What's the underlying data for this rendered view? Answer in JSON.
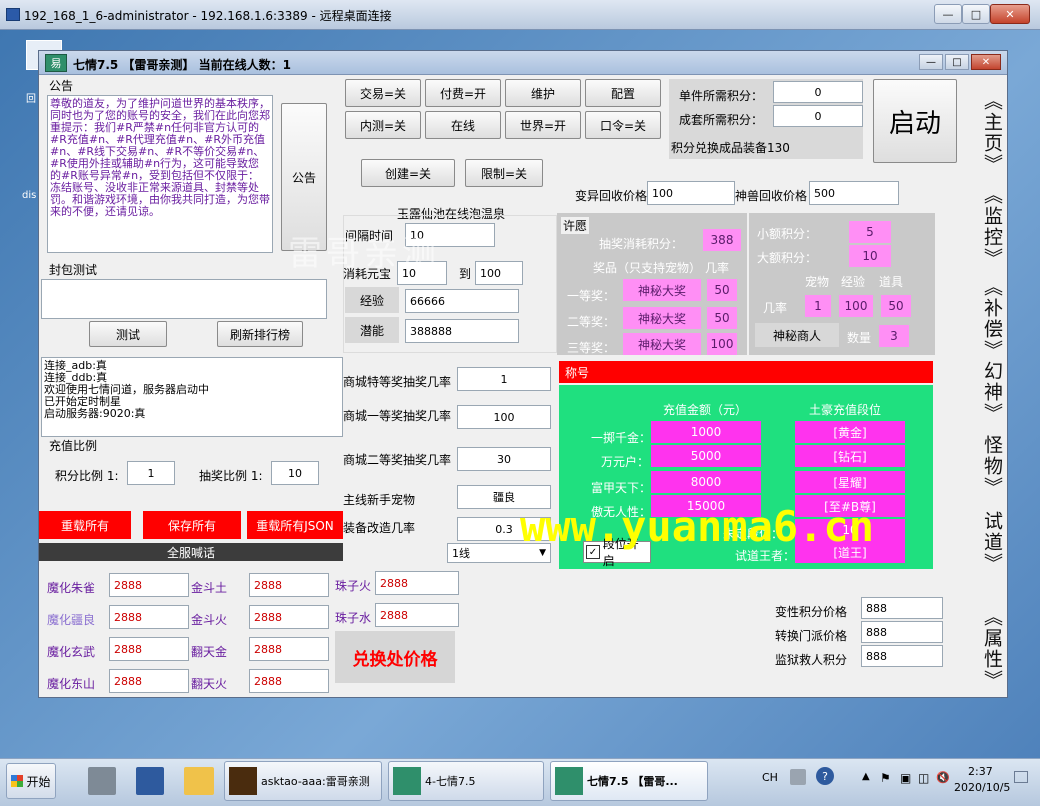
{
  "rdp": {
    "title": "192_168_1_6-administrator - 192.168.1.6:3389 - 远程桌面连接",
    "min": "—",
    "max": "□",
    "close": "✕"
  },
  "desktop": {
    "icon1": "回",
    "icon2": "dis"
  },
  "app": {
    "logo": "易",
    "title": "七情7.5 【雷哥亲测】 当前在线人数：1",
    "min": "—",
    "max": "□",
    "close": "✕",
    "notice": {
      "label": "公告",
      "text": "尊敬的道友，为了维护问道世界的基本秩序，同时也为了您的账号的安全，我们在此向您郑重提示：我们#R严禁#n任何非官方认可的#R充值#n、#R代理充值#n、#R外币充值#n、#R线下交易#n、#R不等价交易#n、#R使用外挂或辅助#n行为，这可能导致您的#R账号异常#n，受到包括但不仅限于：冻结账号、没收非正常来源道具、封禁等处罚。和谐游戏环境，由你我共同打造，为您带来的不便，还请见谅。",
      "button": "公告"
    },
    "packet": {
      "label": "封包测试",
      "test_button": "测试",
      "refresh_button": "刷新排行榜"
    },
    "log": [
      "连接_adb:真",
      "连接_ddb:真",
      "欢迎使用七情问道，服务器启动中",
      "已开始定时制星",
      "启动服务器:9020:真"
    ],
    "recharge": {
      "label": "充值比例",
      "points_label": "积分比例 1:",
      "points_value": "1",
      "lottery_label": "抽奖比例 1:",
      "lottery_value": "10"
    },
    "reload_all": "重载所有",
    "save_all": "保存所有",
    "reload_json": "重载所有JSON",
    "broadcast_label": "全服喊话",
    "exchange": [
      {
        "name": "魔化朱雀",
        "value": "2888"
      },
      {
        "name": "金斗土",
        "value": "2888"
      },
      {
        "name": "珠子火",
        "value": "2888"
      },
      {
        "name": "魔化疆良",
        "value": "2888"
      },
      {
        "name": "金斗火",
        "value": "2888"
      },
      {
        "name": "珠子水",
        "value": "2888"
      },
      {
        "name": "魔化玄武",
        "value": "2888"
      },
      {
        "name": "翻天金",
        "value": "2888"
      },
      {
        "name": "魔化东山",
        "value": "2888"
      },
      {
        "name": "翻天火",
        "value": "2888"
      }
    ],
    "exchange_price_label": "兑换处价格",
    "toggles": [
      "交易=关",
      "付费=开",
      "维护",
      "配置",
      "内测=关",
      "在线",
      "世界=开",
      "口令=关"
    ],
    "create_button": "创建=关",
    "limit_button": "限制=关",
    "pool": {
      "label": "玉露仙池在线泡温泉",
      "interval_label": "间隔时间",
      "interval_value": "10",
      "consume_label": "消耗元宝",
      "consume_value": "10",
      "to_label": "到",
      "to_value": "100",
      "exp_label": "经验",
      "exp_value": "66666",
      "potential_label": "潜能",
      "potential_value": "388888"
    },
    "mall": {
      "special_label": "商城特等奖抽奖几率",
      "special_value": "1",
      "first_label": "商城一等奖抽奖几率",
      "first_value": "100",
      "second_label": "商城二等奖抽奖几率",
      "second_value": "30",
      "pet_label": "主线新手宠物",
      "pet_value": "疆良",
      "modify_label": "装备改造几率",
      "modify_value": "0.3",
      "line_select": "1线",
      "select_arrow": "▼"
    },
    "points": {
      "single_label": "单件所需积分：",
      "single_value": "0",
      "set_label": "成套所需积分：",
      "set_value": "0",
      "exchange_note": "积分兑换成品装备130"
    },
    "start_button": "启动",
    "recycle": {
      "variant_label": "变异回收价格",
      "variant_value": "100",
      "beast_label": "神兽回收价格",
      "beast_value": "500"
    },
    "wish": {
      "label": "许愿",
      "cost_label": "抽奖消耗积分：",
      "cost_value": "388",
      "prize_header": "奖品（只支持宠物）",
      "rate_header": "几率",
      "prizes": [
        {
          "label": "一等奖：",
          "name": "神秘大奖",
          "rate": "50"
        },
        {
          "label": "二等奖：",
          "name": "神秘大奖",
          "rate": "50"
        },
        {
          "label": "三等奖：",
          "name": "神秘大奖",
          "rate": "100"
        }
      ]
    },
    "amount": {
      "small_label": "小额积分：",
      "small_value": "5",
      "large_label": "大额积分：",
      "large_value": "10",
      "col_pet": "宠物",
      "col_exp": "经验",
      "col_item": "道具",
      "rate_label": "几率",
      "rate_pet": "1",
      "rate_exp": "100",
      "rate_item": "50",
      "merchant_label": "神秘商人",
      "count_label": "数量",
      "count_value": "3"
    },
    "titles": {
      "header": "称号",
      "amount_header": "充值金额（元）",
      "rank_header": "土豪充值段位",
      "rows": [
        {
          "label": "一掷千金：",
          "amount": "1000",
          "rank": "[黄金]"
        },
        {
          "label": "万元户：",
          "amount": "5000",
          "rank": "[钻石]"
        },
        {
          "label": "富甲天下：",
          "amount": "8000",
          "rank": "[星耀]"
        },
        {
          "label": "傲无人性：",
          "amount": "15000",
          "rank": "[至#B尊]"
        },
        {
          "label": "未定段位：",
          "amount": "10",
          "rank": "[10拥]"
        },
        {
          "label": "试道王者：",
          "amount": "",
          "rank": "[道王]"
        }
      ],
      "toggle_label": "段位开启",
      "check_mark": "✓"
    },
    "misc": {
      "gender_label": "变性积分价格",
      "gender_value": "888",
      "school_label": "转换门派价格",
      "school_value": "888",
      "jail_label": "监狱救人积分",
      "jail_value": "888"
    },
    "nav": [
      "《主页》",
      "《监控》",
      "《补偿》",
      "幻神》",
      "怪物》",
      "试道》",
      "《属性》"
    ]
  },
  "watermark": {
    "left": "雷哥亲测",
    "right": "www.yuanma6.cn"
  },
  "taskbar": {
    "start": "开始",
    "items": [
      "asktao-aaa:雷哥亲测",
      "4-七情7.5",
      "七情7.5 【雷哥..."
    ],
    "lang": "CH",
    "time": "2:37",
    "date": "2020/10/5",
    "tray_icons": [
      "▲",
      "⚑",
      "▣",
      "◫",
      "🔇"
    ]
  }
}
